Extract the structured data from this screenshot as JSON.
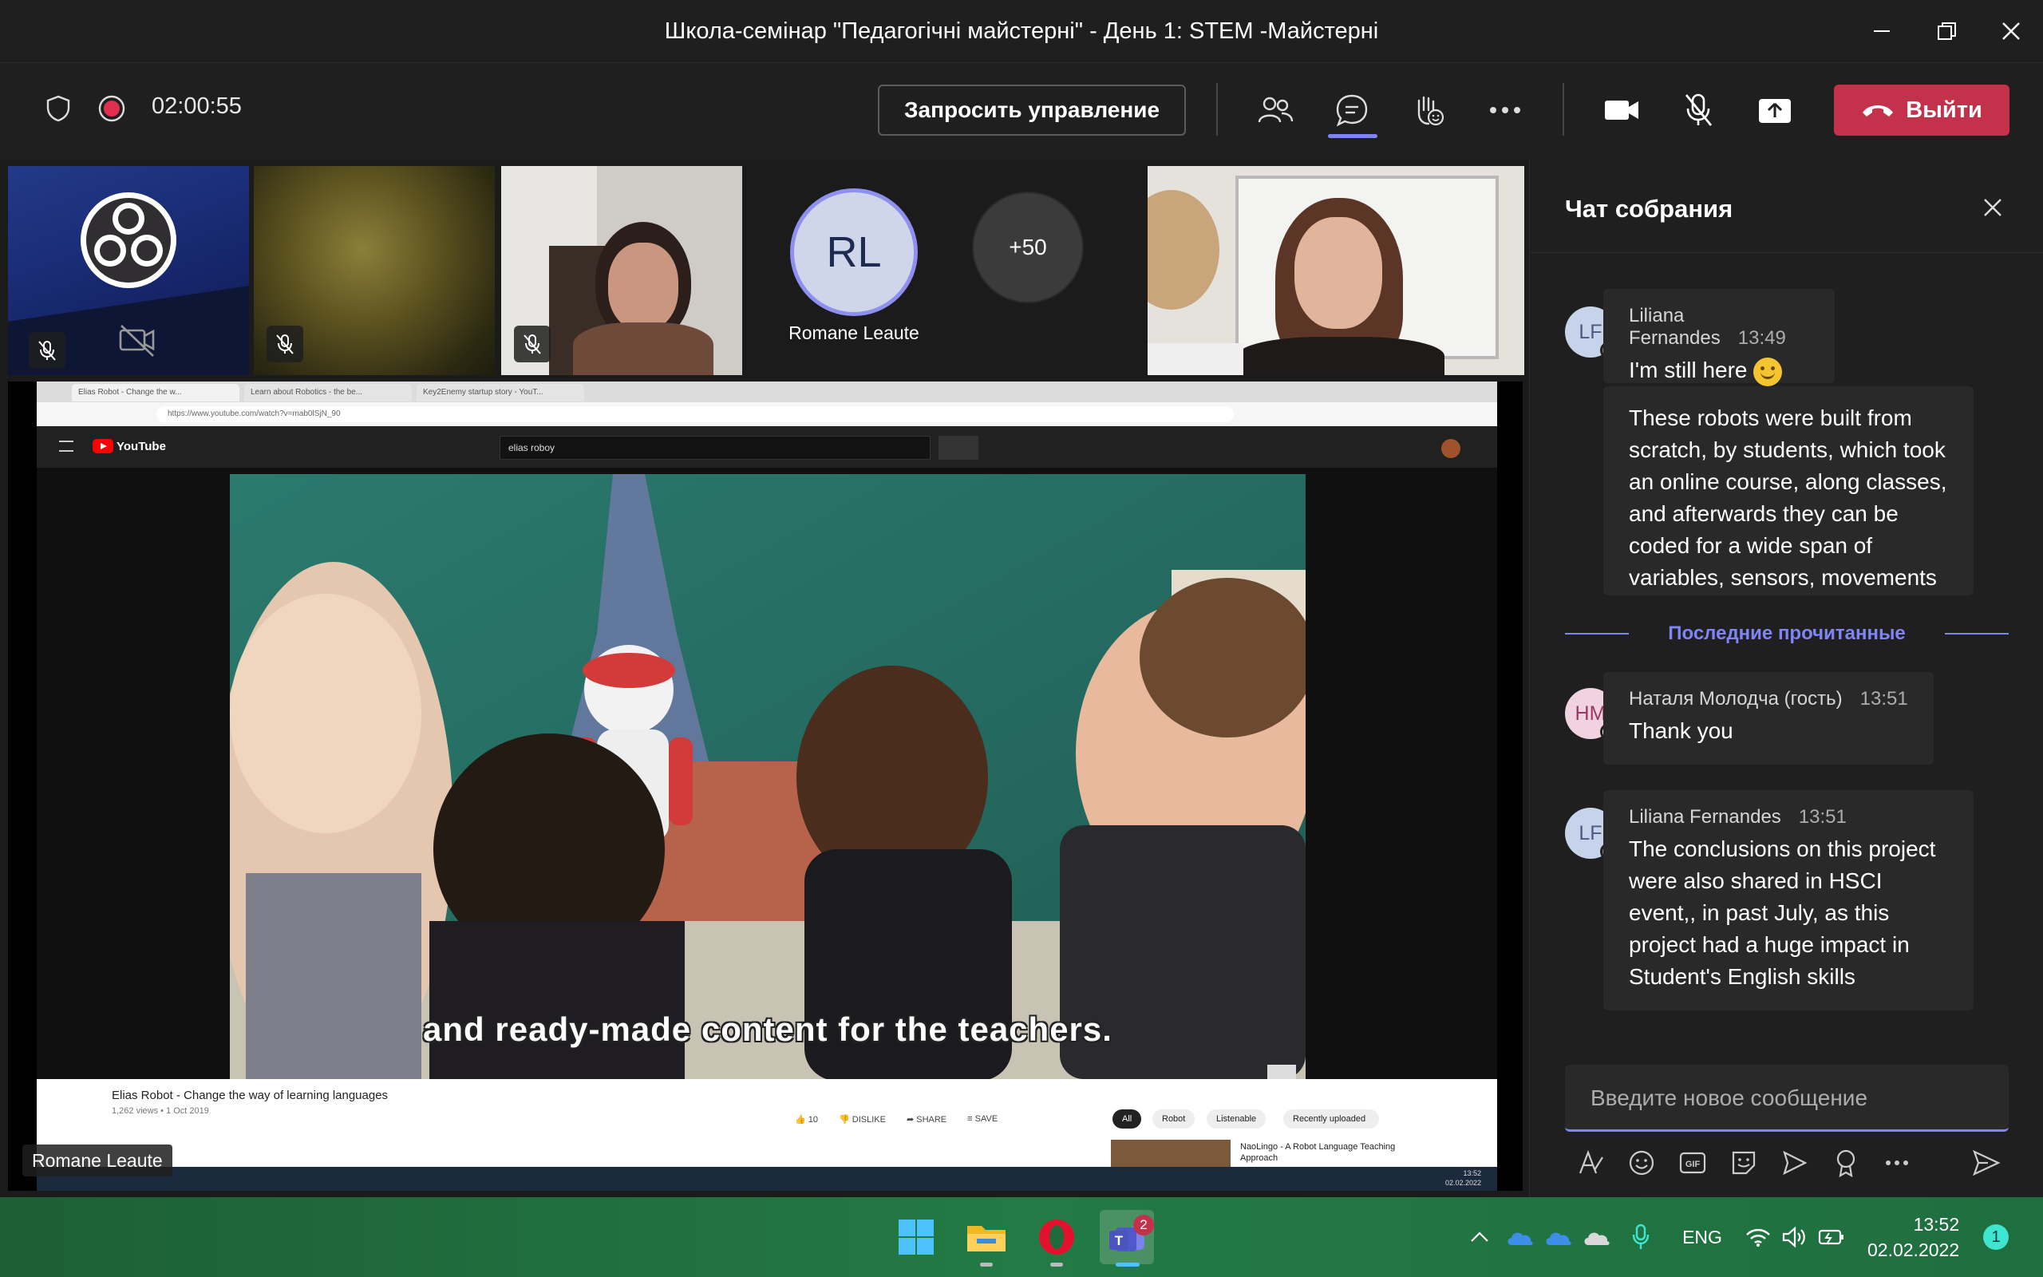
{
  "window": {
    "title": "Школа-семінар \"Педагогічні майстерні\" - День 1: STEM -Майстерні"
  },
  "toolbar": {
    "timer": "02:00:55",
    "request_control": "Запросить управление",
    "leave": "Выйти"
  },
  "participants": {
    "rl_initials": "RL",
    "rl_name": "Romane Leaute",
    "overflow": "+50"
  },
  "share": {
    "presenter": "Romane Leaute",
    "browser_tabs": [
      "Elias Robot - Change the w...",
      "Learn about Robotics - the be...",
      "Key2Enemy startup story - YouT..."
    ],
    "url": "https://www.youtube.com/watch?v=mab0lSjN_90",
    "yt_logo": "YouTube",
    "search": "elias roboy",
    "subtitle": "and ready-made content for the teachers.",
    "video_title": "Elias Robot - Change the way of learning languages",
    "video_meta": "1,262 views • 1 Oct 2019",
    "likes": "10",
    "dislike": "DISLIKE",
    "share_label": "SHARE",
    "save_label": "SAVE",
    "chips": [
      "All",
      "Robot",
      "Listenable",
      "Recently uploaded"
    ],
    "related": "NaoLingo - A Robot Language Teaching Approach",
    "os_time": "13:52",
    "os_date": "02.02.2022"
  },
  "chat": {
    "header": "Чат собрания",
    "last_read": "Последние прочитанные",
    "placeholder": "Введите новое сообщение",
    "messages": [
      {
        "initials": "LF",
        "author": "Liliana Fernandes",
        "time": "13:49",
        "text": "I'm still here"
      },
      {
        "text": "These robots were built from scratch, by students, which took an online course, along classes, and afterwards they can be coded for a wide span of variables, sensors, movements"
      },
      {
        "initials": "НМ",
        "author": "Наталя Молодча (гость)",
        "time": "13:51",
        "text": "Thank you"
      },
      {
        "initials": "LF",
        "author": "Liliana Fernandes",
        "time": "13:51",
        "text": "The conclusions on this project were also shared in HSCI event,, in past July, as this project had a huge impact in Student's English skills"
      }
    ]
  },
  "taskbar": {
    "teams_badge": "2",
    "language": "ENG",
    "time": "13:52",
    "date": "02.02.2022",
    "notifications": "1"
  },
  "colors": {
    "accent": "#7f85f5",
    "leave": "#c4314b",
    "record": "#e0304e",
    "lf_avatar": "#c7d3ea",
    "nm_avatar": "#f1d2e0"
  }
}
